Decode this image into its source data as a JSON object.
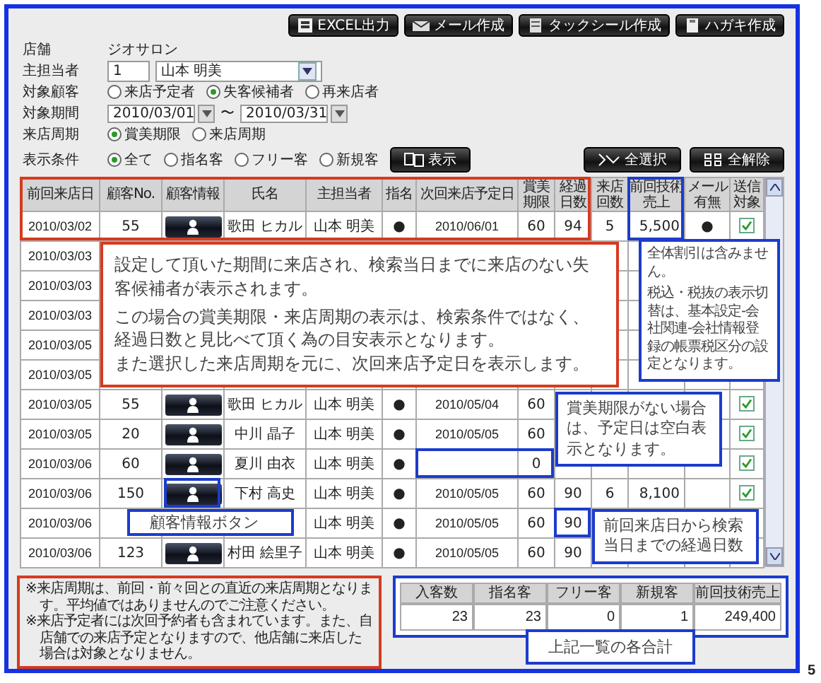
{
  "toolbar_buttons": [
    "EXCEL出力",
    "メール作成",
    "タックシール作成",
    "ハガキ作成"
  ],
  "form": {
    "store_label": "店舗",
    "store": "ジオサロン",
    "staff_label": "主担当者",
    "staff_code": "1",
    "staff_name": "山本 明美",
    "target_label": "対象顧客",
    "target_options": [
      {
        "label": "来店予定者",
        "selected": false
      },
      {
        "label": "失客候補者",
        "selected": true
      },
      {
        "label": "再来店者",
        "selected": false
      }
    ],
    "period_label": "対象期間",
    "period_from": "2010/03/01",
    "period_sep": "〜",
    "period_to": "2010/03/31",
    "cycle_label": "来店周期",
    "cycle_options": [
      {
        "label": "賞美期限",
        "selected": true
      },
      {
        "label": "来店周期",
        "selected": false
      }
    ],
    "filter_label": "表示条件",
    "filter_options": [
      {
        "label": "全て",
        "selected": true
      },
      {
        "label": "指名客",
        "selected": false
      },
      {
        "label": "フリー客",
        "selected": false
      },
      {
        "label": "新規客",
        "selected": false
      }
    ],
    "show_button": "表示"
  },
  "select_all": "全選択",
  "clear_all": "全解除",
  "table": {
    "columns": [
      "前回来店日",
      "顧客No.",
      "顧客情報",
      "氏名",
      "主担当者",
      "指名",
      "次回来店予定日",
      "賞美期限",
      "経過日数",
      "来店回数",
      "前回技術売上",
      "メール有無",
      "送信対象"
    ],
    "rows": [
      {
        "cells": [
          "2010/03/02",
          "55",
          null,
          "歌田 ヒカル",
          "山本 明美",
          "●",
          "2010/06/01",
          "60",
          "94",
          "5",
          "5,500",
          "●"
        ],
        "info_button": true,
        "send": true
      },
      {
        "cells": [
          "2010/03/03"
        ]
      },
      {
        "cells": [
          "2010/03/03"
        ]
      },
      {
        "cells": [
          "2010/03/03"
        ]
      },
      {
        "cells": [
          "2010/03/05"
        ]
      },
      {
        "cells": [
          "2010/03/05"
        ]
      },
      {
        "cells": [
          "2010/03/05",
          "55",
          null,
          "歌田 ヒカル",
          "山本 明美",
          "●",
          "2010/05/04",
          "60"
        ],
        "info_button": true,
        "send": true
      },
      {
        "cells": [
          "2010/03/05",
          "20",
          null,
          "中川 晶子",
          "山本 明美",
          "●",
          "2010/05/05",
          "60"
        ],
        "info_button": true,
        "send": true
      },
      {
        "cells": [
          "2010/03/06",
          "60",
          null,
          "夏川 由衣",
          "山本 明美",
          "●",
          null,
          "0"
        ],
        "info_button": true,
        "send": true
      },
      {
        "cells": [
          "2010/03/06",
          "150",
          null,
          "下村 高史",
          "山本 明美",
          "●",
          "2010/05/05",
          "60",
          "90",
          "6",
          "8,100"
        ],
        "info_button": true,
        "send": true
      },
      {
        "cells": [
          "2010/03/06",
          null,
          null,
          null,
          "山本 明美",
          "●",
          "2010/05/05",
          "60",
          "90"
        ]
      },
      {
        "cells": [
          "2010/03/06",
          "123",
          null,
          "村田 絵里子",
          "山本 明美",
          "●",
          "2010/05/05",
          "60",
          "90"
        ],
        "info_button": true
      }
    ]
  },
  "callouts": [
    {
      "color": "#d63a1f",
      "paragraphs": [
        "設定して頂いた期間に来店され、検索当日までに来店のない失客候補者が表示されます。",
        "この場合の賞美期限・来店周期の表示は、検索条件ではなく、経過日数と見比べて頂く為の目安表示となります。",
        "また選択した来店周期を元に、次回来店予定日を表示します。"
      ]
    },
    {
      "color": "#1c3ccc",
      "paragraphs": [
        "全体割引は含みません。",
        "税込・税抜の表示切替は、基本設定-会社関連-会社情報登録の帳票税区分の設定となります。"
      ]
    },
    {
      "color": "#1c3ccc",
      "paragraphs": [
        "賞美期限がない場合は、予定日は空白表示となります。"
      ]
    },
    {
      "color": "#1c3ccc",
      "paragraphs": [
        "顧客情報ボタン"
      ]
    },
    {
      "color": "#1c3ccc",
      "paragraphs": [
        "前回来店日から検索当日までの経過日数"
      ]
    }
  ],
  "notes": [
    "※来店周期は、前回・前々回との直近の来店周期となります。平均値ではありませんのでご注意ください。",
    "※来店予定者には次回予約者も含まれています。また、自店舗での来店予定となりますので、他店舗に来店した場合は対象となりません。"
  ],
  "summary": {
    "columns": [
      "入客数",
      "指名客",
      "フリー客",
      "新規客",
      "前回技術売上"
    ],
    "values": [
      "23",
      "23",
      "0",
      "1",
      "249,400"
    ],
    "caption": "上記一覧の各合計"
  },
  "page_number": "5"
}
